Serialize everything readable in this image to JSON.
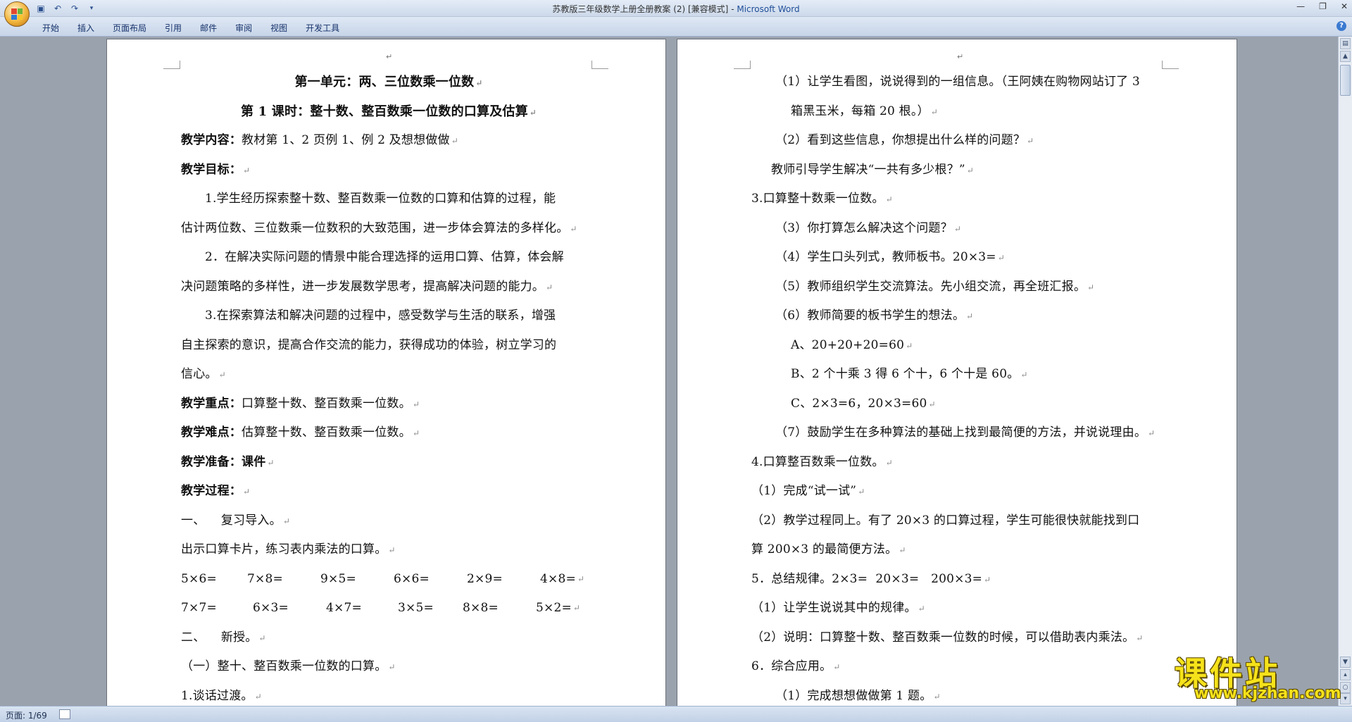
{
  "window": {
    "title": "苏教版三年级数学上册全册教案 (2) [兼容模式]",
    "title_sep": " - ",
    "app_name": "Microsoft Word"
  },
  "ribbon": {
    "tabs": [
      "开始",
      "插入",
      "页面布局",
      "引用",
      "邮件",
      "审阅",
      "视图",
      "开发工具"
    ]
  },
  "left_page": {
    "title": "第一单元：两、三位数乘一位数",
    "subtitle": "第 1 课时：整十数、整百数乘一位数的口算及估算",
    "content_label": "教学内容：",
    "content_text": "教材第 1、2 页例 1、例 2 及想想做做",
    "goal_label": "教学目标：",
    "goal1_a": "1.学生经历探索整十数、整百数乘一位数的口算和估算的过程，能",
    "goal1_b": "估计两位数、三位数乘一位数积的大致范围，进一步体会算法的多样化。",
    "goal2_a": "2．在解决实际问题的情景中能合理选择的运用口算、估算，体会解",
    "goal2_b": "决问题策略的多样性，进一步发展数学思考，提高解决问题的能力。",
    "goal3_a": "3.在探索算法和解决问题的过程中，感受数学与生活的联系，增强",
    "goal3_b": "自主探索的意识，提高合作交流的能力，获得成功的体验，树立学习的",
    "goal3_c": "信心。",
    "key_label": "教学重点：",
    "key_text": "口算整十数、整百数乘一位数。",
    "diff_label": "教学难点：",
    "diff_text": "估算整十数、整百数乘一位数。",
    "prep_label": "教学准备：",
    "prep_text": "课件",
    "process_label": "教学过程：",
    "step1": "一、    复习导入。",
    "step1_text": "出示口算卡片，练习表内乘法的口算。",
    "row1": [
      "5×6=",
      "7×8=",
      "9×5=",
      "6×6=",
      "2×9=",
      "4×8="
    ],
    "row2": [
      "7×7=",
      "6×3=",
      "4×7=",
      "3×5=",
      "8×8=",
      "5×2="
    ],
    "step2": "二、    新授。",
    "step2_sub": "（一）整十、整百数乘一位数的口算。",
    "step2_sub1": "1.谈话过渡。"
  },
  "right_page": {
    "l1a": "（1）让学生看图，说说得到的一组信息。（王阿姨在购物网站订了 3",
    "l1b": "箱黑玉米，每箱 20 根。）",
    "l2": "（2）看到这些信息，你想提出什么样的问题？",
    "l3": "教师引导学生解决“一共有多少根？”",
    "l4": "3.口算整十数乘一位数。",
    "l5": "（3）你打算怎么解决这个问题？",
    "l6": "（4）学生口头列式，教师板书。20×3=",
    "l7": "（5）教师组织学生交流算法。先小组交流，再全班汇报。",
    "l8": "（6）教师简要的板书学生的想法。",
    "l9": "A、20+20+20=60",
    "l10": "B、2 个十乘 3 得 6 个十，6 个十是 60。",
    "l11": "C、2×3=6，20×3=60",
    "l12": "（7）鼓励学生在多种算法的基础上找到最简便的方法，并说说理由。",
    "l13": "4.口算整百数乘一位数。",
    "l14": "（1）完成“试一试”",
    "l15a": "（2）教学过程同上。有了 20×3 的口算过程，学生可能很快就能找到口",
    "l15b": "算 200×3 的最简便方法。",
    "l16": "5．总结规律。2×3=  20×3=   200×3=",
    "l17": "（1）让学生说说其中的规律。",
    "l18": "（2）说明：口算整十数、整百数乘一位数的时候，可以借助表内乘法。",
    "l19": "6．综合应用。",
    "l20": "（1）完成想想做做第 1 题。"
  },
  "status": {
    "page_info": "页面: 1/69"
  },
  "watermark": {
    "name": "课件站",
    "url": "www.kjzhan.com"
  },
  "colors": {
    "ribbon_bg": "#c7d5e8",
    "app_title": "#1f4e99",
    "watermark": "#f6e21a"
  }
}
